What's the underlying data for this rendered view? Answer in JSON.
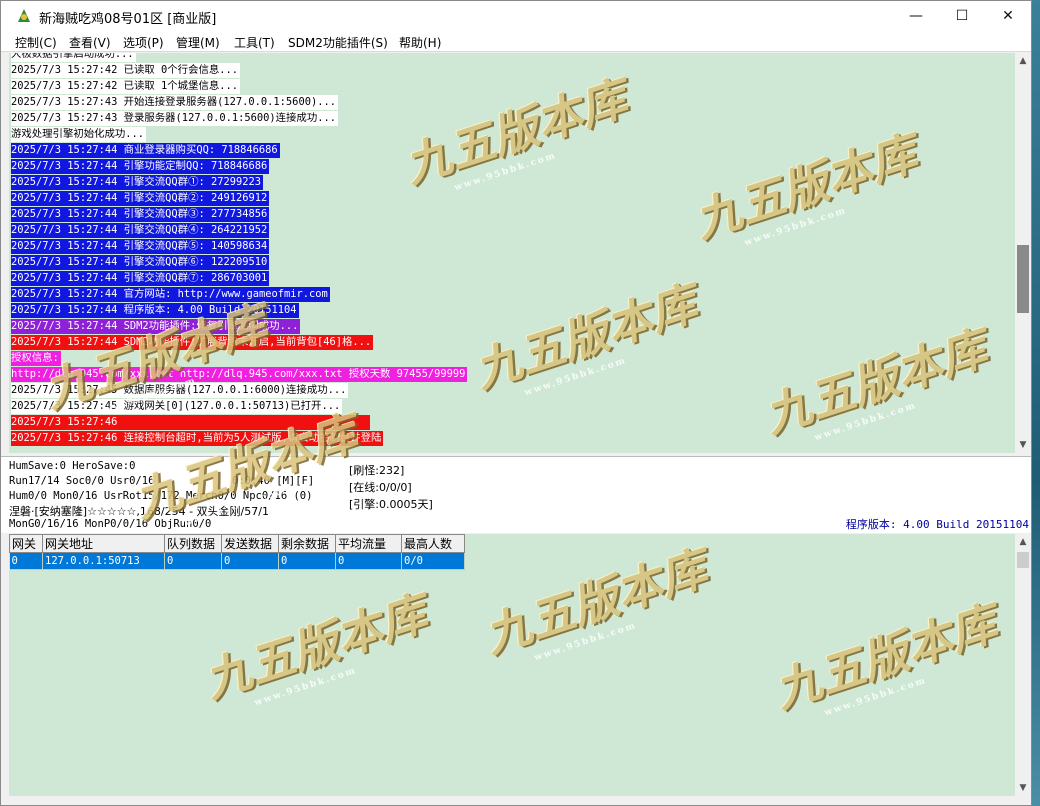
{
  "window": {
    "title": "新海贼吃鸡08号01区 [商业版]",
    "minimize": "—",
    "maximize": "☐",
    "close": "✕"
  },
  "menu": [
    "控制(C)",
    "查看(V)",
    "选项(P)",
    "管理(M)",
    "工具(T)",
    "SDM2功能插件(S)",
    "帮助(H)"
  ],
  "log": [
    {
      "text": "大极数据引擎启动成功...",
      "style": "white"
    },
    {
      "text": "2025/7/3 15:27:42 已读取 0个行会信息...",
      "style": "white"
    },
    {
      "text": "2025/7/3 15:27:42 已读取 1个城堡信息...",
      "style": "white"
    },
    {
      "text": "2025/7/3 15:27:43 开始连接登录服务器(127.0.0.1:5600)...",
      "style": "white"
    },
    {
      "text": "2025/7/3 15:27:43 登录服务器(127.0.0.1:5600)连接成功...",
      "style": "white"
    },
    {
      "text": "游戏处理引擎初始化成功...",
      "style": "white"
    },
    {
      "text": "2025/7/3 15:27:44 商业登录器购买QQ: 718846686",
      "style": "blue"
    },
    {
      "text": "2025/7/3 15:27:44 引擎功能定制QQ: 718846686",
      "style": "blue"
    },
    {
      "text": "2025/7/3 15:27:44 引擎交流QQ群①: 27299223",
      "style": "blue"
    },
    {
      "text": "2025/7/3 15:27:44 引擎交流QQ群②: 249126912",
      "style": "blue"
    },
    {
      "text": "2025/7/3 15:27:44 引擎交流QQ群③: 277734856",
      "style": "blue"
    },
    {
      "text": "2025/7/3 15:27:44 引擎交流QQ群④: 264221952",
      "style": "blue"
    },
    {
      "text": "2025/7/3 15:27:44 引擎交流QQ群⑤: 140598634",
      "style": "blue"
    },
    {
      "text": "2025/7/3 15:27:44 引擎交流QQ群⑥: 122209510",
      "style": "blue"
    },
    {
      "text": "2025/7/3 15:27:44 引擎交流QQ群⑦: 286703001",
      "style": "blue"
    },
    {
      "text": "2025/7/3 15:27:44 官方网站: http://www.gameofmir.com",
      "style": "blue"
    },
    {
      "text": "2025/7/3 15:27:44 程序版本: 4.00 Build 20151104",
      "style": "blue"
    },
    {
      "text": "2025/7/3 15:27:44 SDM2功能插件:修复引擎漏洞成功...",
      "style": "purple"
    },
    {
      "text": "2025/7/3 15:27:44 SDM2功能插件:扩展背包未开启,当前背包[46]格...",
      "style": "red"
    },
    {
      "text": "授权信息:",
      "style": "magenta"
    },
    {
      "text": "http://dlq.945.com/xxx.txt http://dlq.945.com/xxx.txt 授权天数 97455/99999",
      "style": "magenta"
    },
    {
      "text": "2025/7/3 15:27:45 数据库服务器(127.0.0.1:6000)连接成功...",
      "style": "white"
    },
    {
      "text": "2025/7/3 15:27:45 游戏网关[0](127.0.0.1:50713)已打开...",
      "style": "white"
    },
    {
      "text": "2025/7/3 15:27:46                                        ",
      "style": "red"
    },
    {
      "text": "2025/7/3 15:27:46 连接控制台超时,当前为5人测试版,请启动控制台并登陆",
      "style": "red"
    }
  ],
  "status": {
    "line1": "HumSave:0 HeroSave:0",
    "line2": "Run17/14 Soc0/0 Usr0/16",
    "line2b": "0:0:40 [M][F]",
    "line3": "Hum0/0 Mon0/16 UsrRot15/172 Merch0/0 Npc0/16 (0)",
    "line4": "涅磐·[安纳塞隆]☆☆☆☆☆,168/254 - 双头金刚/57/1",
    "line5": "MonG0/16/16 MonP0/0/16 ObjRun0/0",
    "refresh": "[刷怪:232]",
    "online": "[在线:0/0/0]",
    "engine": "[引擎:0.0005天]",
    "build": "程序版本: 4.00 Build 20151104"
  },
  "gateway": {
    "headers": [
      "网关",
      "网关地址",
      "队列数据",
      "发送数据",
      "剩余数据",
      "平均流量",
      "最高人数"
    ],
    "rows": [
      [
        "0",
        "127.0.0.1:50713",
        "0",
        "0",
        "0",
        "0",
        "0/0"
      ]
    ]
  },
  "watermark": {
    "text": "九五版本库",
    "url": "www.95bbk.com"
  }
}
